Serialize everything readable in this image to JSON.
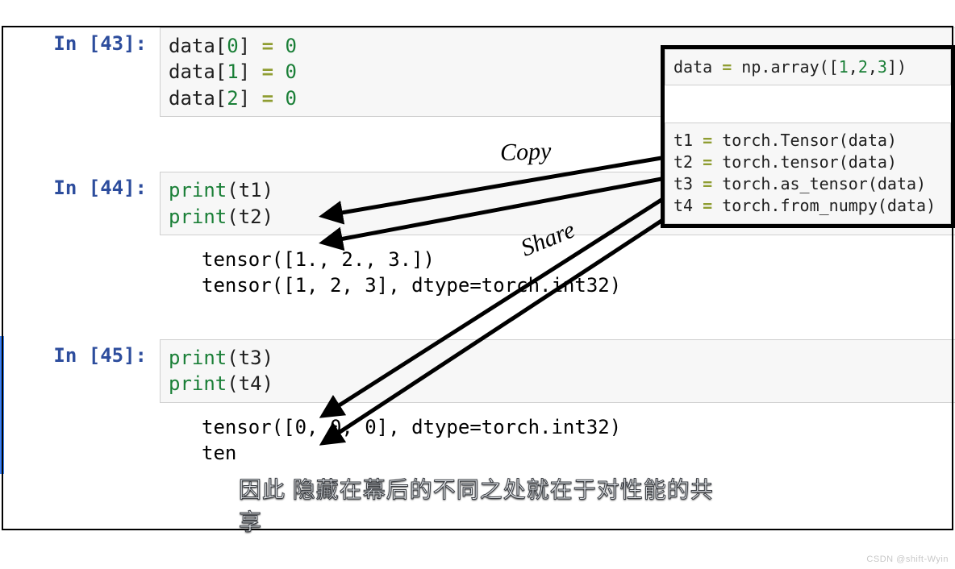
{
  "cells": [
    {
      "prompt": "In [43]:",
      "tokens": [
        [
          [
            "data[",
            "default"
          ],
          [
            "0",
            "green"
          ],
          [
            "] ",
            "default"
          ],
          [
            "=",
            "olive"
          ],
          [
            " ",
            "default"
          ],
          [
            "0",
            "green"
          ]
        ],
        [
          [
            "data[",
            "default"
          ],
          [
            "1",
            "green"
          ],
          [
            "] ",
            "default"
          ],
          [
            "=",
            "olive"
          ],
          [
            " ",
            "default"
          ],
          [
            "0",
            "green"
          ]
        ],
        [
          [
            "data[",
            "default"
          ],
          [
            "2",
            "green"
          ],
          [
            "] ",
            "default"
          ],
          [
            "=",
            "olive"
          ],
          [
            " ",
            "default"
          ],
          [
            "0",
            "green"
          ]
        ]
      ]
    },
    {
      "prompt": "In [44]:",
      "tokens": [
        [
          [
            "print",
            "green"
          ],
          [
            "(t1)",
            "default"
          ]
        ],
        [
          [
            "print",
            "green"
          ],
          [
            "(t2)",
            "default"
          ]
        ]
      ],
      "output": [
        "tensor([1., 2., 3.])",
        "tensor([1, 2, 3], dtype=torch.int32)"
      ]
    },
    {
      "prompt": "In [45]:",
      "selected": true,
      "tokens": [
        [
          [
            "print",
            "green"
          ],
          [
            "(t3)",
            "default"
          ]
        ],
        [
          [
            "print",
            "green"
          ],
          [
            "(t4)",
            "default"
          ]
        ]
      ],
      "output": [
        "tensor([0, 0, 0], dtype=torch.int32)",
        "ten"
      ]
    }
  ],
  "annotation": {
    "top_lines": [
      [
        [
          "data ",
          "default"
        ],
        [
          "=",
          "olive"
        ],
        [
          " np",
          "default"
        ],
        [
          ".",
          "default"
        ],
        [
          "array([",
          "default"
        ],
        [
          "1",
          "green"
        ],
        [
          ",",
          "default"
        ],
        [
          "2",
          "green"
        ],
        [
          ",",
          "default"
        ],
        [
          "3",
          "green"
        ],
        [
          "])",
          "default"
        ]
      ]
    ],
    "bottom_lines": [
      [
        [
          "t1 ",
          "default"
        ],
        [
          "=",
          "olive"
        ],
        [
          " torch",
          "default"
        ],
        [
          ".",
          "default"
        ],
        [
          "Tensor(data)",
          "default"
        ]
      ],
      [
        [
          "t2 ",
          "default"
        ],
        [
          "=",
          "olive"
        ],
        [
          " torch",
          "default"
        ],
        [
          ".",
          "default"
        ],
        [
          "tensor(data)",
          "default"
        ]
      ],
      [
        [
          "t3 ",
          "default"
        ],
        [
          "=",
          "olive"
        ],
        [
          " torch",
          "default"
        ],
        [
          ".",
          "default"
        ],
        [
          "as_tensor(data)",
          "default"
        ]
      ],
      [
        [
          "t4 ",
          "default"
        ],
        [
          "=",
          "olive"
        ],
        [
          " torch",
          "default"
        ],
        [
          ".",
          "default"
        ],
        [
          "from_numpy(data)",
          "default"
        ]
      ]
    ],
    "label_copy": "Copy",
    "label_share": "Share"
  },
  "subtitle": "因此 隐藏在幕后的不同之处就在于对性能的共享",
  "watermark": "CSDN @shift-Wyin"
}
